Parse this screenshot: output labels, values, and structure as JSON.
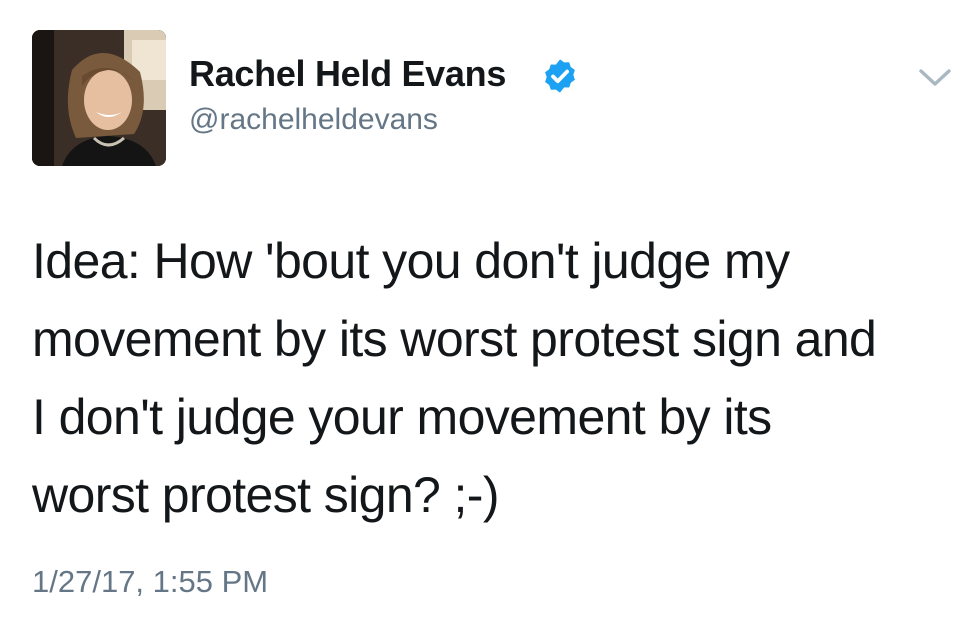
{
  "tweet": {
    "author": {
      "display_name": "Rachel Held Evans",
      "handle": "@rachelheldevans",
      "verified": true,
      "avatar_icon": "profile-photo"
    },
    "text_lines": [
      "Idea: How 'bout you don't judge my",
      "movement by its worst protest sign and",
      "I don't judge your movement by its",
      "worst protest sign? ;-)"
    ],
    "timestamp": "1/27/17, 1:55 PM",
    "menu_icon": "chevron-down-icon"
  },
  "colors": {
    "text_primary": "#14171a",
    "text_secondary": "#657786",
    "verified_blue": "#1da1f2",
    "chevron": "#aab8c2"
  }
}
